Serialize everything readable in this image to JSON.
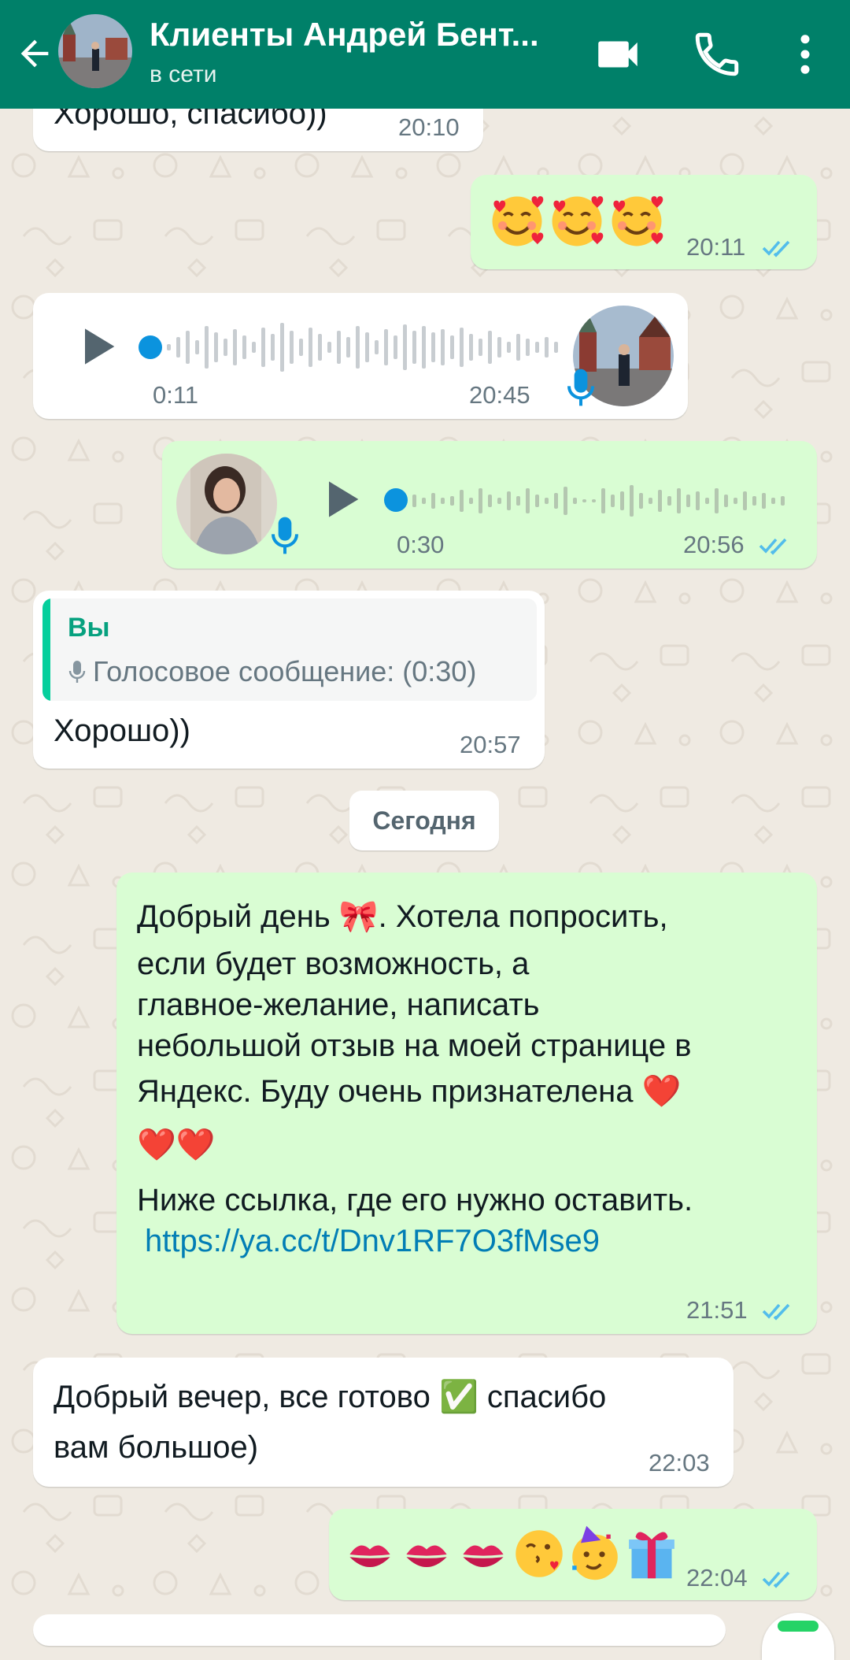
{
  "header": {
    "title": "Клиенты Андрей Бент...",
    "status": "в сети",
    "back_icon": "arrow-left-icon",
    "actions": [
      "video-call-icon",
      "phone-icon",
      "more-vertical-icon"
    ],
    "color": "#008069"
  },
  "messages": [
    {
      "id": "m1",
      "direction": "in",
      "text": "Хорошо, спасибо))",
      "time": "20:10"
    },
    {
      "id": "m2",
      "direction": "out",
      "emoji": [
        "smiling-face-with-hearts",
        "smiling-face-with-hearts",
        "smiling-face-with-hearts"
      ],
      "time": "20:11",
      "read": true
    },
    {
      "id": "m3",
      "direction": "in",
      "type": "voice",
      "duration": "0:11",
      "time": "20:45",
      "progress": 0
    },
    {
      "id": "m4",
      "direction": "out",
      "type": "voice",
      "duration": "0:30",
      "time": "20:56",
      "progress": 0,
      "read": true
    },
    {
      "id": "m5",
      "direction": "in",
      "quote": {
        "author": "Вы",
        "text": "Голосовое сообщение: (0:30)"
      },
      "text": "Хорошо))",
      "time": "20:57"
    },
    {
      "id": "m6",
      "direction": "out",
      "line1": "Добрый день 🎀.  Хотела попросить,",
      "line2": "если будет возможность,  а",
      "line3": "главное-желание,  написать",
      "line4": "небольшой отзыв на моей странице в",
      "line5": "Яндекс.  Буду очень признателена ❤️",
      "line6": "❤️❤️",
      "line7": "Ниже ссылка, где его нужно оставить.",
      "link": "https://ya.cc/t/Dnv1RF7O3fMse9",
      "time": "21:51",
      "read": true
    },
    {
      "id": "m7",
      "direction": "in",
      "line1": "Добрый вечер, все готово ✅ спасибо",
      "line2": "вам большое)",
      "time": "22:03"
    },
    {
      "id": "m8",
      "direction": "out",
      "emoji": [
        "kiss-mark",
        "kiss-mark",
        "kiss-mark",
        "face-blowing-kiss",
        "partying-face",
        "wrapped-gift"
      ],
      "time": "22:04",
      "read": true
    }
  ],
  "date_divider": "Сегодня",
  "colors": {
    "outgoing": "#d9fdd3",
    "incoming": "#ffffff",
    "accent": "#008069",
    "read_tick": "#53bdeb",
    "link": "#027eb5",
    "voice_dot": "#0b93de"
  }
}
